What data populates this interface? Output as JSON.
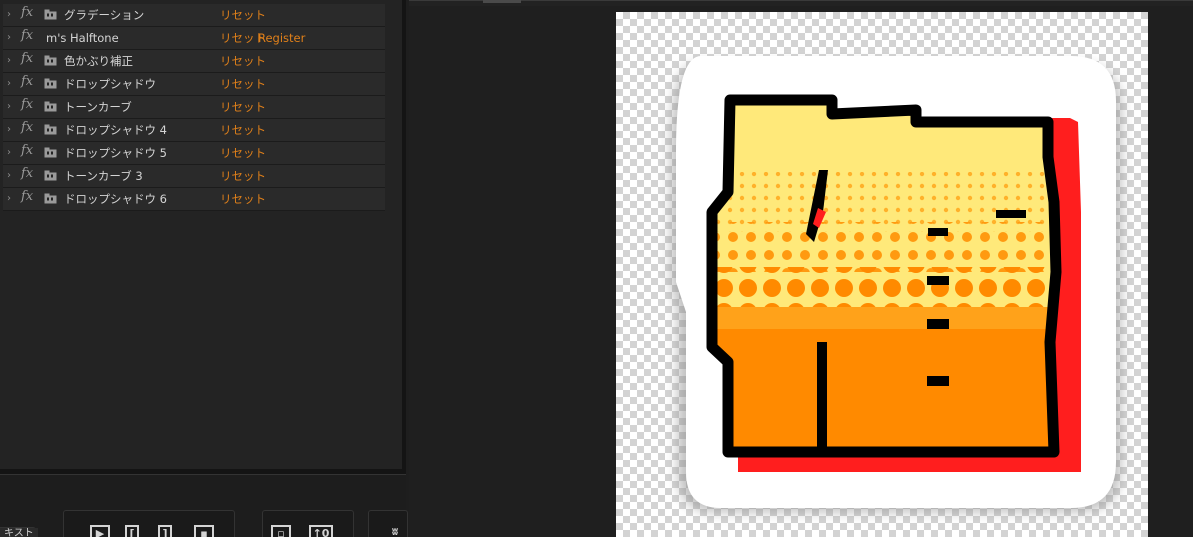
{
  "effects": [
    {
      "name": "グラデーション",
      "reset": "リセット",
      "extra": "",
      "icon": "folder-icon"
    },
    {
      "name": "m's Halftone",
      "reset": "リセット",
      "extra": "Register",
      "icon": "none"
    },
    {
      "name": "色かぶり補正",
      "reset": "リセット",
      "extra": "",
      "icon": "folder-icon"
    },
    {
      "name": "ドロップシャドウ",
      "reset": "リセット",
      "extra": "",
      "icon": "folder-icon"
    },
    {
      "name": "トーンカーブ",
      "reset": "リセット",
      "extra": "",
      "icon": "folder-icon"
    },
    {
      "name": "ドロップシャドウ 4",
      "reset": "リセット",
      "extra": "",
      "icon": "folder-icon"
    },
    {
      "name": "ドロップシャドウ 5",
      "reset": "リセット",
      "extra": "",
      "icon": "folder-icon"
    },
    {
      "name": "トーンカーブ 3",
      "reset": "リセット",
      "extra": "",
      "icon": "folder-icon"
    },
    {
      "name": "ドロップシャドウ 6",
      "reset": "リセット",
      "extra": "",
      "icon": "folder-icon"
    }
  ],
  "fx_symbol": "fx",
  "chevron_symbol": "›",
  "toolbar": {
    "text_label": "キスト",
    "last_btn": "ʬ"
  },
  "colors": {
    "panel_bg": "#232323",
    "row_bg": "#2a2a2a",
    "accent_orange": "#e0801a",
    "art_yellow": "#ffe97a",
    "art_orange": "#ff8a00",
    "art_red": "#ff1e1e",
    "art_outline": "#000000",
    "art_border": "#ffffff"
  }
}
